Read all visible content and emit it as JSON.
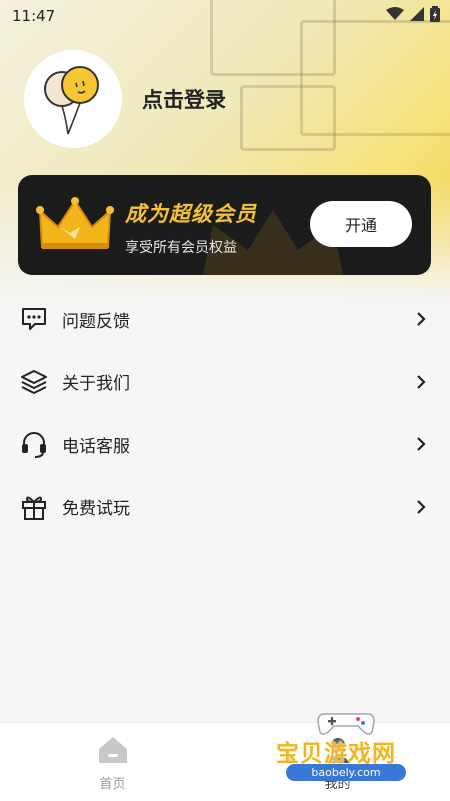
{
  "status_bar": {
    "time": "11:47"
  },
  "profile": {
    "login_text": "点击登录"
  },
  "vip": {
    "title": "成为超级会员",
    "subtitle": "享受所有会员权益",
    "button_label": "开通",
    "accent_color": "#f3c233"
  },
  "menu": {
    "items": [
      {
        "label": "问题反馈",
        "icon": "chat-feedback-icon"
      },
      {
        "label": "关于我们",
        "icon": "layers-icon"
      },
      {
        "label": "电话客服",
        "icon": "headset-icon"
      },
      {
        "label": "免费试玩",
        "icon": "gift-icon"
      }
    ]
  },
  "tabbar": {
    "tabs": [
      {
        "label": "首页",
        "icon": "home-icon"
      },
      {
        "label": "我的",
        "icon": "profile-icon"
      }
    ]
  },
  "watermark": {
    "title": "宝贝游戏网",
    "url": "baobely.com"
  }
}
